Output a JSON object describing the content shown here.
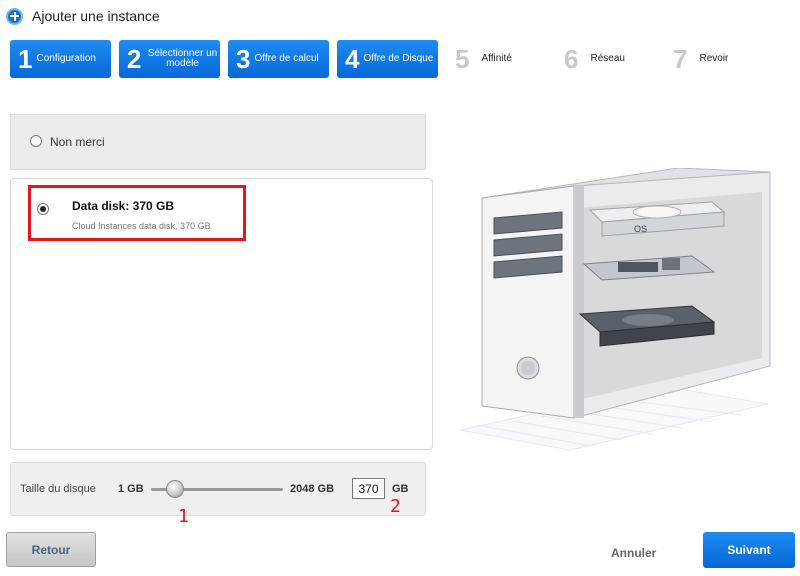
{
  "header": {
    "title": "Ajouter une instance",
    "icon": "plus-circle-icon"
  },
  "steps": [
    {
      "num": "1",
      "label": "Configuration",
      "state": "active"
    },
    {
      "num": "2",
      "label": "Sélectionner un modèle",
      "state": "active"
    },
    {
      "num": "3",
      "label": "Offre de calcul",
      "state": "active"
    },
    {
      "num": "4",
      "label": "Offre de Disque",
      "state": "active"
    },
    {
      "num": "5",
      "label": "Affinité",
      "state": "inactive"
    },
    {
      "num": "6",
      "label": "Réseau",
      "state": "inactive"
    },
    {
      "num": "7",
      "label": "Revoir",
      "state": "inactive"
    }
  ],
  "options": {
    "none_label": "Non merci",
    "disk_title": "Data disk: 370 GB",
    "disk_subtitle": "Cloud Instances data disk, 370 GB",
    "selected": "disk"
  },
  "slider": {
    "label": "Taille du disque",
    "min_label": "1 GB",
    "max_label": "2048 GB",
    "value": "370",
    "unit": "GB",
    "position_fraction": 0.18
  },
  "annotations": {
    "slider_marker": "1",
    "input_marker": "2"
  },
  "illustration": {
    "os_label": "OS"
  },
  "buttons": {
    "back": "Retour",
    "cancel": "Annuler",
    "next": "Suivant"
  },
  "colors": {
    "accent": "#0b72dd",
    "highlight": "#e3151e"
  }
}
